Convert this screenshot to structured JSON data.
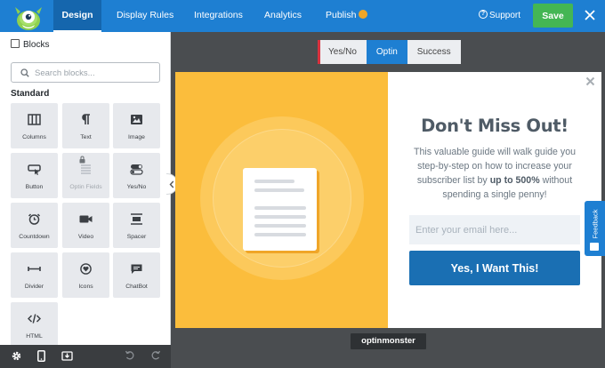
{
  "topbar": {
    "tabs": [
      {
        "label": "Design"
      },
      {
        "label": "Display Rules"
      },
      {
        "label": "Integrations"
      },
      {
        "label": "Analytics"
      },
      {
        "label": "Publish"
      }
    ],
    "support_label": "Support",
    "save_label": "Save",
    "accent": "#1e7fd2",
    "save_color": "#44b654",
    "publish_badge_color": "#f0a628"
  },
  "sidebar": {
    "title": "Blocks",
    "search_placeholder": "Search blocks...",
    "section": "Standard",
    "blocks": [
      {
        "label": "Columns",
        "icon": "columns-icon"
      },
      {
        "label": "Text",
        "icon": "paragraph-icon"
      },
      {
        "label": "Image",
        "icon": "image-icon"
      },
      {
        "label": "Button",
        "icon": "button-icon"
      },
      {
        "label": "Optin Fields",
        "icon": "form-icon",
        "locked": true
      },
      {
        "label": "Yes/No",
        "icon": "toggle-icon"
      },
      {
        "label": "Countdown",
        "icon": "alarm-clock-icon"
      },
      {
        "label": "Video",
        "icon": "video-camera-icon"
      },
      {
        "label": "Spacer",
        "icon": "spacer-icon"
      },
      {
        "label": "Divider",
        "icon": "divider-icon"
      },
      {
        "label": "Icons",
        "icon": "heart-circle-icon"
      },
      {
        "label": "ChatBot",
        "icon": "chat-icon"
      },
      {
        "label": "HTML",
        "icon": "code-icon"
      }
    ]
  },
  "view_tabs": [
    {
      "label": "Yes/No"
    },
    {
      "label": "Optin"
    },
    {
      "label": "Success"
    }
  ],
  "popup": {
    "headline": "Don't Miss Out!",
    "body_before": "This valuable guide will walk guide you step-by-step on how to increase your subscriber list by ",
    "body_bold": "up to 500%",
    "body_after": " without spending a single penny!",
    "email_placeholder": "Enter your email here...",
    "cta_label": "Yes, I Want This!",
    "left_color": "#fbbd3c",
    "cta_color": "#1a6fb3"
  },
  "feedback_label": "Feedback",
  "footer_logo": "optinmonster"
}
